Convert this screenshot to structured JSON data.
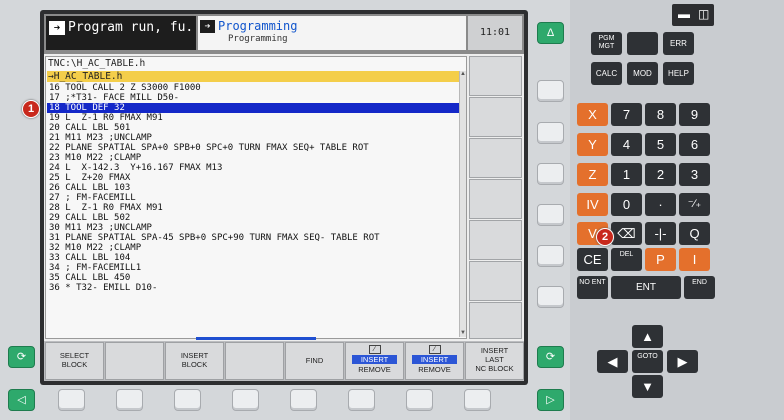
{
  "header": {
    "mode_primary": "Program run, fu...",
    "mode_secondary_title": "Programming",
    "mode_secondary_sub": "Programming",
    "clock": "11:01"
  },
  "program": {
    "path": "TNC:\\H_AC_TABLE.h",
    "file": "→H_AC_TABLE.h",
    "selected_index": 2,
    "lines": [
      "16 TOOL CALL 2 Z S3000 F1000",
      "17 ;*T31- FACE MILL D50-",
      "18 TOOL DEF 32",
      "19 L  Z-1 R0 FMAX M91",
      "20 CALL LBL 501",
      "21 M11 M23 ;UNCLAMP",
      "22 PLANE SPATIAL SPA+0 SPB+0 SPC+0 TURN FMAX SEQ+ TABLE ROT",
      "23 M10 M22 ;CLAMP",
      "24 L  X-142.3  Y+16.167 FMAX M13",
      "25 L  Z+20 FMAX",
      "26 CALL LBL 103",
      "27 ; FM-FACEMILL",
      "28 L  Z-1 R0 FMAX M91",
      "29 CALL LBL 502",
      "30 M11 M23 ;UNCLAMP",
      "31 PLANE SPATIAL SPA-45 SPB+0 SPC+90 TURN FMAX SEQ- TABLE ROT",
      "32 M10 M22 ;CLAMP",
      "33 CALL LBL 104",
      "34 ; FM-FACEMILL1",
      "35 CALL LBL 450",
      "36 * T32- EMILL D10-"
    ]
  },
  "softkeys": {
    "select_block_1": "SELECT",
    "select_block_2": "BLOCK",
    "insert_block_1": "INSERT",
    "insert_block_2": "BLOCK",
    "find": "FIND",
    "insert_remove_1_top": "INSERT",
    "insert_remove_1_bot": "REMOVE",
    "insert_remove_2_top": "INSERT",
    "insert_remove_2_bot": "REMOVE",
    "insert_last_1": "INSERT",
    "insert_last_2": "LAST",
    "insert_last_3": "NC BLOCK"
  },
  "bezel": {
    "delta": "Δ"
  },
  "keypad": {
    "pgm_mgt": "PGM MGT",
    "err": "ERR",
    "calc": "CALC",
    "mod": "MOD",
    "help": "HELP",
    "x": "X",
    "y": "Y",
    "z": "Z",
    "iv": "IV",
    "v": "V",
    "n7": "7",
    "n8": "8",
    "n9": "9",
    "n4": "4",
    "n5": "5",
    "n6": "6",
    "n1": "1",
    "n2": "2",
    "n3": "3",
    "n0": "0",
    "dot": "·",
    "plusminus": "⁻∕₊",
    "q": "Q",
    "ce": "CE",
    "del": "DEL",
    "p": "P",
    "i": "I",
    "no_ent": "NO ENT",
    "ent": "ENT",
    "end": "END",
    "goto": "GOTO"
  },
  "markers": {
    "m1": "1",
    "m2": "2"
  },
  "colors": {
    "selection": "#1428c8",
    "file_highlight": "#f4ce4a",
    "orange_key": "#e4702c",
    "green_bezel": "#2ea96c"
  }
}
